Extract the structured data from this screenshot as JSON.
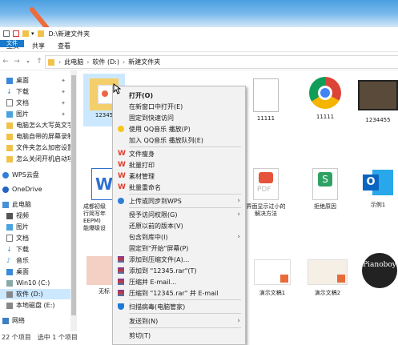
{
  "window": {
    "title_path": "D:\\新建文件夹",
    "ribbon_tabs": [
      "文件",
      "主页",
      "共享",
      "查看"
    ]
  },
  "address": {
    "crumbs": [
      "此电脑",
      "软件 (D:)",
      "新建文件夹"
    ]
  },
  "nav": {
    "items": [
      {
        "label": "桌面",
        "pinned": true
      },
      {
        "label": "下载",
        "pinned": true
      },
      {
        "label": "文档",
        "pinned": true
      },
      {
        "label": "图片",
        "pinned": true
      },
      {
        "label": "电脑怎么大写英文字"
      },
      {
        "label": "电脑自带的屏幕录制"
      },
      {
        "label": "文件夹怎么加密设置"
      },
      {
        "label": "怎么关闭开机启动项"
      },
      {
        "label": "WPS云盘"
      },
      {
        "label": "OneDrive"
      },
      {
        "label": "此电脑"
      },
      {
        "label": "视频"
      },
      {
        "label": "图片"
      },
      {
        "label": "文档"
      },
      {
        "label": "下载"
      },
      {
        "label": "音乐"
      },
      {
        "label": "桌面"
      },
      {
        "label": "Win10 (C:)"
      },
      {
        "label": "软件 (D:)"
      },
      {
        "label": "本地磁盘 (E:)"
      },
      {
        "label": "网络"
      }
    ]
  },
  "files": [
    {
      "label": "12345"
    },
    {
      "label": ""
    },
    {
      "label": "11111"
    },
    {
      "label": "11111"
    },
    {
      "label": "1234455"
    },
    {
      "label": "成都初级\n行简写年\nEEPM)\n能爆级设"
    },
    {
      "label": ""
    },
    {
      "label": "界面显示过小的\n解决方法"
    },
    {
      "label": "拒绝原因"
    },
    {
      "label": "示例1"
    },
    {
      "label": "无标"
    },
    {
      "label": "演示文稿1"
    },
    {
      "label": "演示文稿2"
    },
    {
      "label": ""
    }
  ],
  "thumbnail_text": {
    "pianoboy": "Pianoboy"
  },
  "context_menu": {
    "items": [
      {
        "label": "打开(O)",
        "bold": true
      },
      {
        "label": "在新窗口中打开(E)"
      },
      {
        "label": "固定到快速访问"
      },
      {
        "label": "使用 QQ音乐 播放(P)",
        "icon": "qq-music-icon"
      },
      {
        "label": "加入 QQ音乐 播放队列(E)"
      },
      {
        "label": "文件瘦身",
        "icon": "wps-icon"
      },
      {
        "label": "批量打印",
        "icon": "wps-icon"
      },
      {
        "label": "素材管理",
        "icon": "wps-icon"
      },
      {
        "label": "批量重命名",
        "icon": "wps-icon"
      },
      {
        "label": "上传或同步到WPS",
        "icon": "cloud-icon",
        "submenu": true
      },
      {
        "label": "授予访问权限(G)",
        "submenu": true
      },
      {
        "label": "还原以前的版本(V)"
      },
      {
        "label": "包含到库中(I)",
        "submenu": true
      },
      {
        "label": "固定到\"开始\"屏幕(P)"
      },
      {
        "label": "添加到压缩文件(A)...",
        "icon": "winrar-icon"
      },
      {
        "label": "添加到 \"12345.rar\"(T)",
        "icon": "winrar-icon"
      },
      {
        "label": "压缩并 E-mail...",
        "icon": "winrar-icon"
      },
      {
        "label": "压缩到 \"12345.rar\" 并 E-mail",
        "icon": "winrar-icon"
      },
      {
        "label": "扫描病毒(电脑管家)",
        "icon": "shield-icon"
      },
      {
        "label": "发送到(N)",
        "submenu": true
      },
      {
        "label": "剪切(T)"
      }
    ]
  },
  "status": {
    "count": "22 个项目",
    "selection": "选中 1 个项目"
  },
  "colors": {
    "accent": "#1979ca",
    "arrow": "#ee6b3c",
    "menu_bg": "#f2f2f2"
  }
}
